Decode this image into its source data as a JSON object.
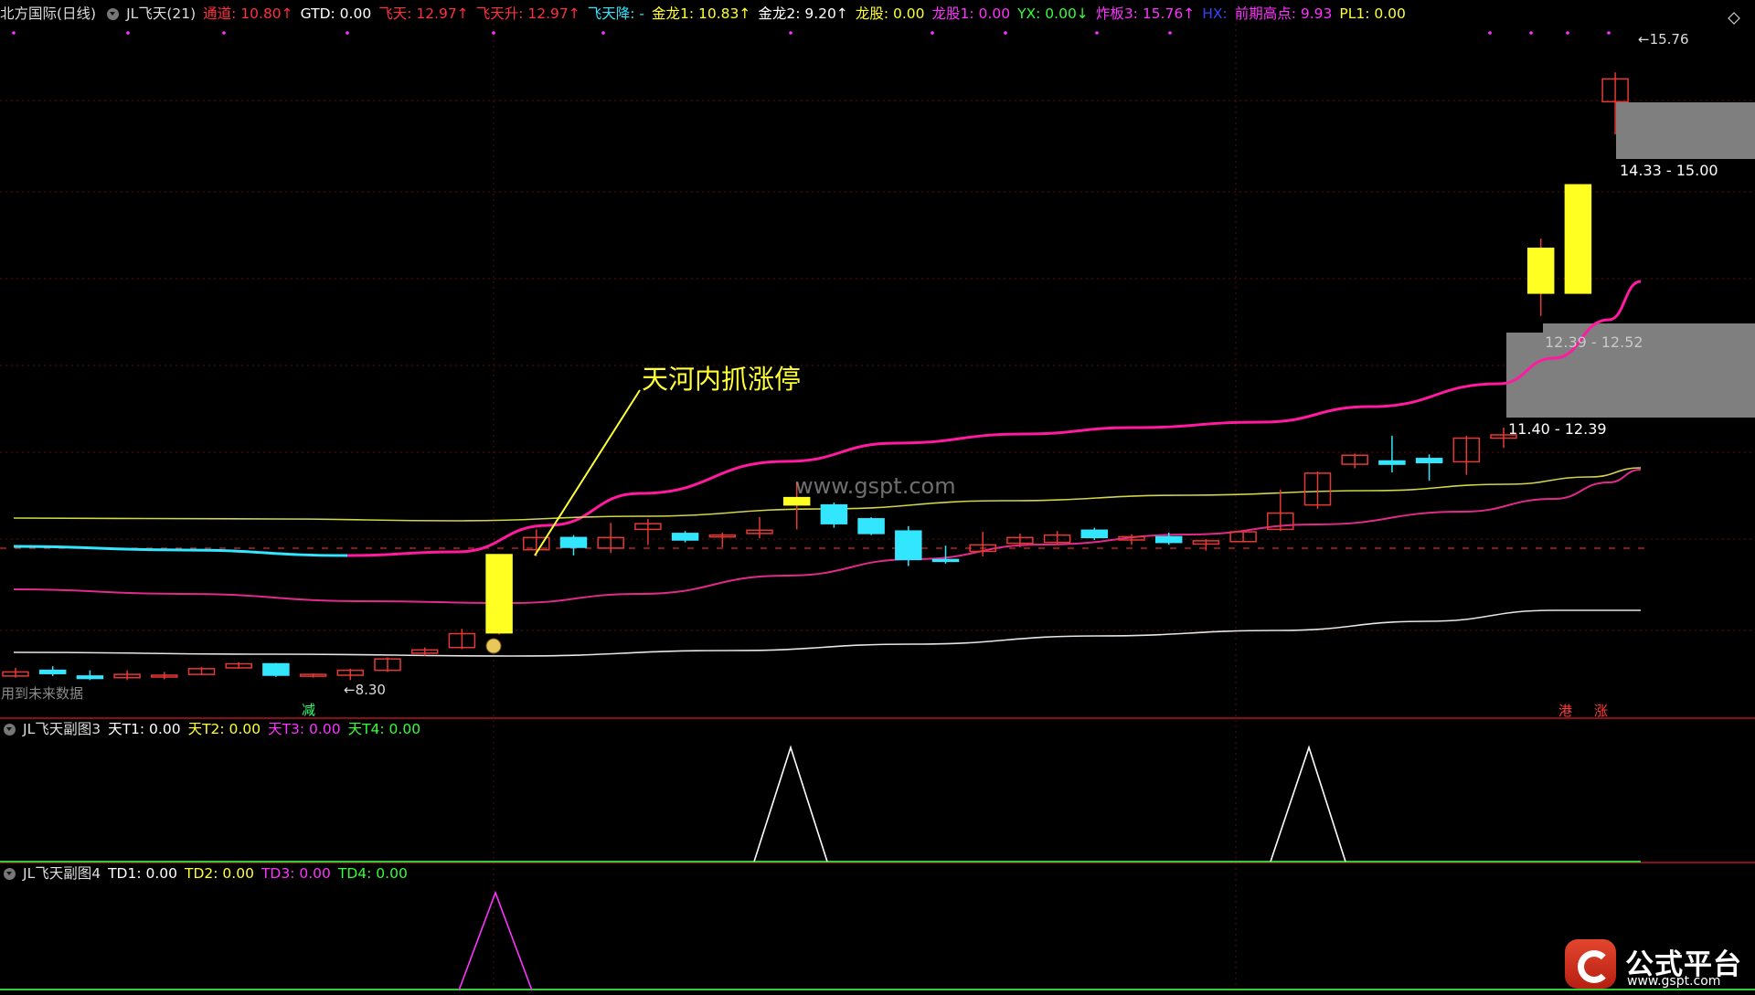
{
  "header_main": {
    "items": [
      {
        "text": "北方国际(日线)",
        "color": "#dddddd"
      },
      {
        "text": "JL飞天(21)",
        "color": "#dddddd",
        "circle": true
      },
      {
        "text": "通道: 10.80↑",
        "color": "#ff3040"
      },
      {
        "text": "GTD: 0.00",
        "color": "#ffffff"
      },
      {
        "text": "飞天: 12.97↑",
        "color": "#ff3040"
      },
      {
        "text": "飞天升: 12.97↑",
        "color": "#ff3040"
      },
      {
        "text": "飞天降: -",
        "color": "#32e6ff"
      },
      {
        "text": "金龙1: 10.83↑",
        "color": "#ffff33"
      },
      {
        "text": "金龙2: 9.20↑",
        "color": "#ffffff"
      },
      {
        "text": "龙股: 0.00",
        "color": "#ffff33"
      },
      {
        "text": "龙股1: 0.00",
        "color": "#ff33ff"
      },
      {
        "text": "YX: 0.00↓",
        "color": "#33ff33"
      },
      {
        "text": "炸板3: 15.76↑",
        "color": "#ff33ff"
      },
      {
        "text": "HX:",
        "color": "#3344ff"
      },
      {
        "text": "前期高点: 9.93",
        "color": "#ff33ff"
      },
      {
        "text": "PL1: 0.00",
        "color": "#ffff33"
      }
    ]
  },
  "header_sub3": {
    "items": [
      {
        "text": "JL飞天副图3",
        "color": "#dddddd",
        "circle": true
      },
      {
        "text": "天T1: 0.00",
        "color": "#ffffff"
      },
      {
        "text": "天T2: 0.00",
        "color": "#ffff33"
      },
      {
        "text": "天T3: 0.00",
        "color": "#ff33ff"
      },
      {
        "text": "天T4: 0.00",
        "color": "#33ff33"
      }
    ]
  },
  "header_sub4": {
    "items": [
      {
        "text": "JL飞天副图4",
        "color": "#dddddd",
        "circle": true
      },
      {
        "text": "TD1: 0.00",
        "color": "#ffffff"
      },
      {
        "text": "TD2: 0.00",
        "color": "#ffff33"
      },
      {
        "text": "TD3: 0.00",
        "color": "#ff33ff"
      },
      {
        "text": "TD4: 0.00",
        "color": "#33ff33"
      }
    ]
  },
  "annotation": {
    "text": "天河内抓涨停",
    "color": "#ffff33"
  },
  "watermark_site": "www.gspt.com",
  "future_data_note": "用到未来数据",
  "low_marker": "←8.30",
  "high_marker": "←15.76",
  "signal_jian": "减",
  "signal_gang": "港",
  "signal_zhang": "涨",
  "zones": [
    {
      "label": "14.33 - 15.00"
    },
    {
      "label": "12.39 - 12.52"
    },
    {
      "label": "11.40 - 12.39"
    }
  ],
  "logo": {
    "name": "公式平台",
    "site": "www.gspt.com"
  },
  "colors": {
    "up": "#e53935",
    "down": "#32e6ff",
    "limit": "#ffff22",
    "magenta": "#ff1aa0",
    "yellow_line": "#d4d44a",
    "white_line": "#e6e6e6",
    "grid": "#5a0d0d",
    "separator": "#b3161c"
  },
  "chart_data": {
    "type": "candlestick",
    "price_range": [
      7.9,
      16.2
    ],
    "candles": [
      {
        "o": 8.4,
        "h": 8.45,
        "l": 8.33,
        "c": 8.35,
        "color": "up"
      },
      {
        "o": 8.42,
        "h": 8.47,
        "l": 8.35,
        "c": 8.38,
        "color": "down"
      },
      {
        "o": 8.35,
        "h": 8.42,
        "l": 8.3,
        "c": 8.32,
        "color": "down"
      },
      {
        "o": 8.33,
        "h": 8.42,
        "l": 8.3,
        "c": 8.37,
        "color": "up"
      },
      {
        "o": 8.34,
        "h": 8.4,
        "l": 8.31,
        "c": 8.36,
        "color": "up"
      },
      {
        "o": 8.37,
        "h": 8.46,
        "l": 8.36,
        "c": 8.44,
        "color": "up"
      },
      {
        "o": 8.45,
        "h": 8.52,
        "l": 8.44,
        "c": 8.5,
        "color": "up"
      },
      {
        "o": 8.5,
        "h": 8.51,
        "l": 8.34,
        "c": 8.36,
        "color": "down"
      },
      {
        "o": 8.35,
        "h": 8.38,
        "l": 8.33,
        "c": 8.37,
        "color": "up"
      },
      {
        "o": 8.36,
        "h": 8.44,
        "l": 8.3,
        "c": 8.42,
        "color": "up"
      },
      {
        "o": 8.42,
        "h": 8.58,
        "l": 8.4,
        "c": 8.56,
        "color": "up"
      },
      {
        "o": 8.63,
        "h": 8.7,
        "l": 8.6,
        "c": 8.67,
        "color": "up"
      },
      {
        "o": 8.7,
        "h": 8.93,
        "l": 8.68,
        "c": 8.87,
        "color": "up"
      },
      {
        "o": 8.88,
        "h": 9.84,
        "l": 8.86,
        "c": 9.84,
        "color": "limit"
      },
      {
        "o": 9.9,
        "h": 10.15,
        "l": 9.82,
        "c": 10.05,
        "color": "up"
      },
      {
        "o": 10.05,
        "h": 10.08,
        "l": 9.83,
        "c": 9.93,
        "color": "down"
      },
      {
        "o": 9.92,
        "h": 10.23,
        "l": 9.86,
        "c": 10.05,
        "color": "up"
      },
      {
        "o": 10.15,
        "h": 10.28,
        "l": 9.96,
        "c": 10.22,
        "color": "up"
      },
      {
        "o": 10.1,
        "h": 10.13,
        "l": 9.99,
        "c": 10.02,
        "color": "down"
      },
      {
        "o": 10.06,
        "h": 10.11,
        "l": 9.93,
        "c": 10.08,
        "color": "up"
      },
      {
        "o": 10.1,
        "h": 10.3,
        "l": 10.04,
        "c": 10.14,
        "color": "up"
      },
      {
        "o": 10.45,
        "h": 10.73,
        "l": 10.15,
        "c": 10.54,
        "color": "limit"
      },
      {
        "o": 10.45,
        "h": 10.48,
        "l": 10.17,
        "c": 10.22,
        "color": "down"
      },
      {
        "o": 10.28,
        "h": 10.3,
        "l": 10.08,
        "c": 10.1,
        "color": "down"
      },
      {
        "o": 10.13,
        "h": 10.19,
        "l": 9.7,
        "c": 9.78,
        "color": "down"
      },
      {
        "o": 9.78,
        "h": 9.95,
        "l": 9.73,
        "c": 9.78,
        "color": "down"
      },
      {
        "o": 9.88,
        "h": 10.12,
        "l": 9.82,
        "c": 9.96,
        "color": "up"
      },
      {
        "o": 9.98,
        "h": 10.1,
        "l": 9.93,
        "c": 10.05,
        "color": "up"
      },
      {
        "o": 9.99,
        "h": 10.13,
        "l": 9.96,
        "c": 10.08,
        "color": "up"
      },
      {
        "o": 10.14,
        "h": 10.17,
        "l": 10.02,
        "c": 10.05,
        "color": "down"
      },
      {
        "o": 10.02,
        "h": 10.09,
        "l": 9.96,
        "c": 10.06,
        "color": "up"
      },
      {
        "o": 10.06,
        "h": 10.11,
        "l": 9.96,
        "c": 9.99,
        "color": "down"
      },
      {
        "o": 9.97,
        "h": 10.03,
        "l": 9.89,
        "c": 10.01,
        "color": "up"
      },
      {
        "o": 10.0,
        "h": 10.13,
        "l": 9.99,
        "c": 10.12,
        "color": "up"
      },
      {
        "o": 10.15,
        "h": 10.64,
        "l": 10.13,
        "c": 10.35,
        "color": "up"
      },
      {
        "o": 10.45,
        "h": 10.86,
        "l": 10.4,
        "c": 10.84,
        "color": "up"
      },
      {
        "o": 10.95,
        "h": 11.08,
        "l": 10.9,
        "c": 11.06,
        "color": "up"
      },
      {
        "o": 10.99,
        "h": 11.3,
        "l": 10.85,
        "c": 10.95,
        "color": "down"
      },
      {
        "o": 11.02,
        "h": 11.07,
        "l": 10.75,
        "c": 10.97,
        "color": "down"
      },
      {
        "o": 10.98,
        "h": 11.3,
        "l": 10.82,
        "c": 11.27,
        "color": "up"
      },
      {
        "o": 11.27,
        "h": 11.4,
        "l": 11.15,
        "c": 11.31,
        "color": "up"
      },
      {
        "o": 13.6,
        "h": 13.72,
        "l": 12.77,
        "c": 13.05,
        "color": "limit"
      },
      {
        "o": 13.05,
        "h": 14.38,
        "l": 13.05,
        "c": 14.38,
        "color": "limit"
      },
      {
        "o": 15.4,
        "h": 15.76,
        "l": 15.0,
        "c": 15.68,
        "color": "up"
      }
    ],
    "series": [
      {
        "name": "通道",
        "color": "magenta"
      },
      {
        "name": "飞天",
        "color": "magenta"
      },
      {
        "name": "金龙1",
        "color": "yellow"
      },
      {
        "name": "金龙2",
        "color": "white"
      }
    ]
  }
}
